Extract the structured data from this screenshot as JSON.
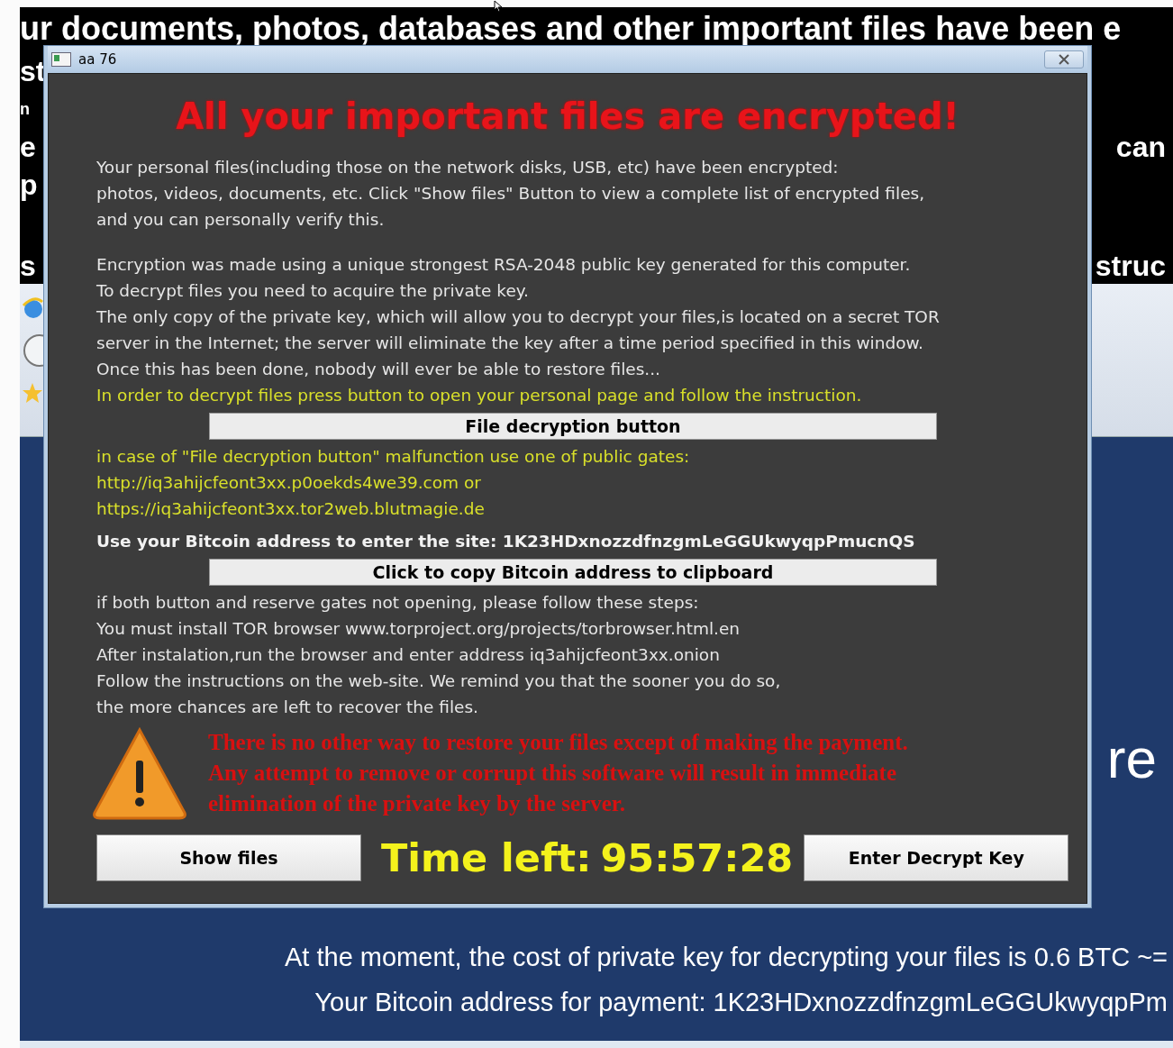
{
  "background": {
    "headline": "ur documents, photos, databases and other important files have been e",
    "rows": [
      {
        "left": "st"
      },
      {
        "left": "n"
      },
      {
        "left": "e",
        "right": "can"
      },
      {
        "left": "p"
      },
      {
        "left": "s",
        "right": "struc"
      }
    ],
    "big_fragment": "re",
    "cost_line": "At the moment, the cost of private key for decrypting your files is 0.6 BTC ~=",
    "address_line": "Your Bitcoin address for payment: 1K23HDxnozzdfnzgmLeGGUkwyqpPm"
  },
  "dialog": {
    "title": "aa 76",
    "heading": "All your important files are encrypted!",
    "blocks": [
      {
        "kind": "text",
        "lines": [
          "Your personal files(including those on the network disks, USB, etc) have been encrypted:",
          "photos, videos, documents, etc. Click \"Show files\" Button to view a complete list of encrypted files,",
          "and you can personally verify this."
        ]
      },
      {
        "kind": "text",
        "lines": [
          "Encryption was made using a unique strongest RSA-2048 public key generated for this computer.",
          "To decrypt files you need to acquire the private key.",
          "The only copy of the private key, which will allow you to decrypt your files,is located on a secret TOR",
          "server in the Internet; the server will eliminate the key after a time period specified in this window.",
          "Once this has been done, nobody will ever be able to restore files..."
        ]
      },
      {
        "kind": "notice",
        "lines": [
          "In order to decrypt files press button to open your personal page and follow the instruction."
        ]
      },
      {
        "kind": "button",
        "label": "File decryption button"
      },
      {
        "kind": "notice",
        "lines": [
          "in case of \"File decryption button\" malfunction use one of public gates:",
          "http://iq3ahijcfeont3xx.p0oekds4we39.com or",
          "https://iq3ahijcfeont3xx.tor2web.blutmagie.de"
        ]
      },
      {
        "kind": "emphasis",
        "lines": [
          "Use your Bitcoin address to  enter the site: 1K23HDxnozzdfnzgmLeGGUkwyqpPmucnQS"
        ]
      },
      {
        "kind": "button",
        "label": "Click to copy Bitcoin address to clipboard"
      },
      {
        "kind": "text",
        "lines": [
          "if both button and reserve gates not opening, please follow these steps:",
          "You must install TOR browser www.torproject.org/projects/torbrowser.html.en",
          "After instalation,run the browser and enter address iq3ahijcfeont3xx.onion",
          "Follow the instructions on the web-site. We remind you that the sooner you do so,",
          "the more chances are left to recover the files."
        ]
      }
    ],
    "warning_lines": [
      "There is no other way to restore your files except of making the payment.",
      "Any attempt to remove or corrupt this software will result in immediate",
      "elimination of the private key by the server."
    ],
    "show_files_button": "Show files",
    "timer": {
      "label": "Time left:",
      "value": "95:57:28"
    },
    "decrypt_key_button": "Enter Decrypt Key"
  }
}
